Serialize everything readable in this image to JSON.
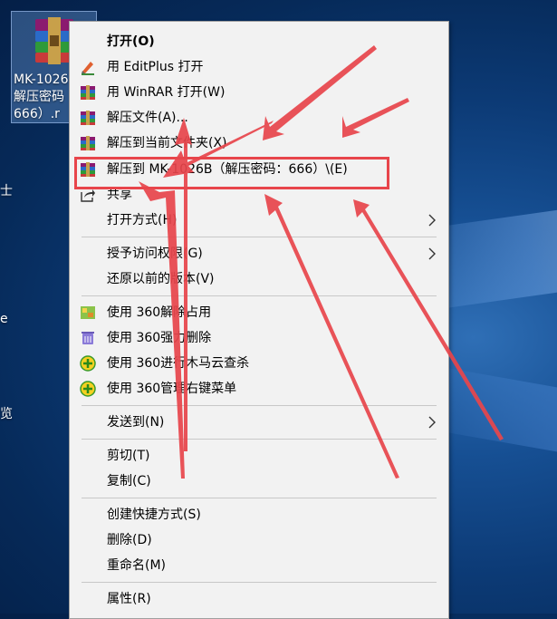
{
  "desktop": {
    "icon_label_lines": [
      "MK-1026",
      "解压密码",
      "666）.r"
    ],
    "edge_texts": [
      "士",
      "e",
      "览"
    ]
  },
  "menu": {
    "items": [
      {
        "id": "open",
        "label": "打开(O)",
        "bold": true,
        "icon": "none"
      },
      {
        "id": "editplus",
        "label": "用 EditPlus 打开",
        "icon": "editplus-icon"
      },
      {
        "id": "winrar",
        "label": "用 WinRAR 打开(W)",
        "icon": "winrar-icon"
      },
      {
        "id": "extract-files",
        "label": "解压文件(A)...",
        "icon": "winrar-icon"
      },
      {
        "id": "extract-here",
        "label": "解压到当前文件夹(X)",
        "icon": "winrar-icon"
      },
      {
        "id": "extract-to",
        "label": "解压到 MK-1026B（解压密码：666）\\(E)",
        "icon": "winrar-icon"
      },
      {
        "id": "share",
        "label": "共享",
        "icon": "share-icon"
      },
      {
        "id": "open-with",
        "label": "打开方式(H)",
        "icon": "none",
        "submenu": true
      },
      {
        "id": "grant-access",
        "label": "授予访问权限(G)",
        "icon": "none",
        "submenu": true
      },
      {
        "id": "restore",
        "label": "还原以前的版本(V)",
        "icon": "none"
      },
      {
        "id": "360-unlock",
        "label": "使用 360解除占用",
        "icon": "360-unlock-icon"
      },
      {
        "id": "360-delete",
        "label": "使用 360强力删除",
        "icon": "360-delete-icon"
      },
      {
        "id": "360-scan",
        "label": "使用 360进行木马云查杀",
        "icon": "360-shield-icon"
      },
      {
        "id": "360-manage",
        "label": "使用 360管理右键菜单",
        "icon": "360-shield-icon"
      },
      {
        "id": "send-to",
        "label": "发送到(N)",
        "icon": "none",
        "submenu": true
      },
      {
        "id": "cut",
        "label": "剪切(T)",
        "icon": "none"
      },
      {
        "id": "copy",
        "label": "复制(C)",
        "icon": "none"
      },
      {
        "id": "shortcut",
        "label": "创建快捷方式(S)",
        "icon": "none"
      },
      {
        "id": "delete",
        "label": "删除(D)",
        "icon": "none"
      },
      {
        "id": "rename",
        "label": "重命名(M)",
        "icon": "none"
      },
      {
        "id": "properties",
        "label": "属性(R)",
        "icon": "none"
      }
    ]
  },
  "colors": {
    "menu_bg": "#f2f2f2",
    "highlight_box": "#e8454b",
    "arrow": "#e8454b"
  }
}
